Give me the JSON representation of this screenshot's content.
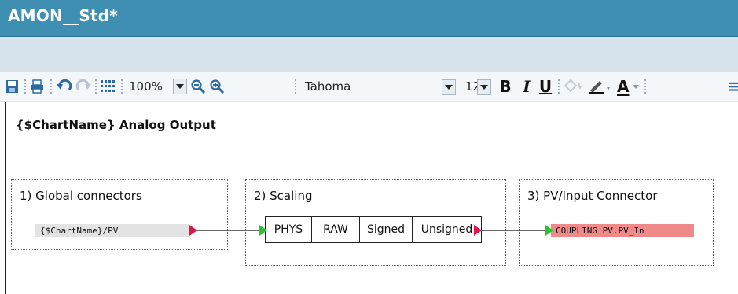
{
  "window": {
    "title": "AMON__Std*"
  },
  "toolbar": {
    "zoom": "100%",
    "font_name": "Tahoma",
    "font_size": "12",
    "bold": "B",
    "italic": "I",
    "underline": "U",
    "font_color": "A"
  },
  "sheet": {
    "title": "{$ChartName} Analog Output",
    "groups": {
      "global": {
        "label": "1) Global connectors",
        "connector": "{$ChartName}/PV"
      },
      "scaling": {
        "label": "2) Scaling",
        "columns": [
          "PHYS",
          "RAW",
          "Signed",
          "Unsigned"
        ]
      },
      "pv": {
        "label": "3) PV/Input Connector",
        "connector": "COUPLING PV.PV_In"
      }
    }
  },
  "colors": {
    "title_bar": "#3e8fb1",
    "group_border": "#4b55d6",
    "output_pin": "#e0144c",
    "input_pin": "#2fc12f",
    "pv_field": "#f08a8a"
  }
}
